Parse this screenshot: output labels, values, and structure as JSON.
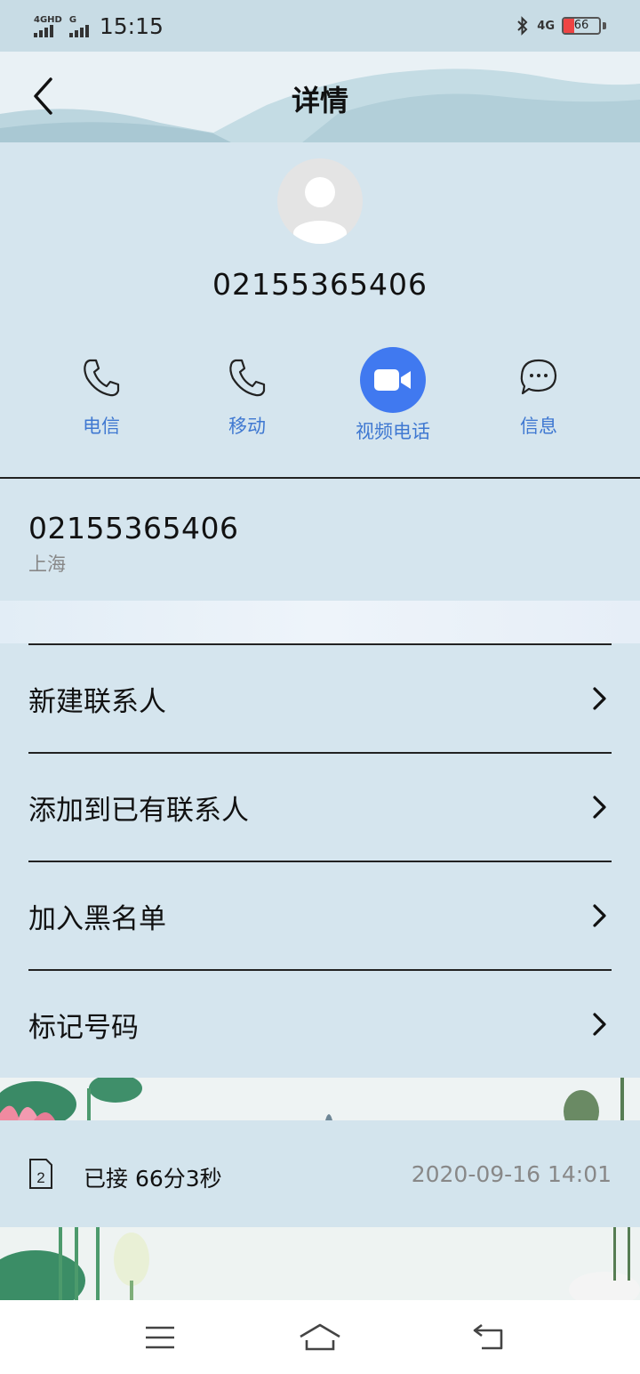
{
  "status_bar": {
    "sim1_label": "4GHD",
    "sim2_label": "G",
    "time": "15:15",
    "network": "4G",
    "battery": "66"
  },
  "header": {
    "title": "详情"
  },
  "contact": {
    "number": "02155365406"
  },
  "actions": [
    {
      "label": "电信",
      "icon": "phone-icon"
    },
    {
      "label": "移动",
      "icon": "phone-icon"
    },
    {
      "label": "视频电话",
      "icon": "video-camera-icon"
    },
    {
      "label": "信息",
      "icon": "message-icon"
    }
  ],
  "phone_entry": {
    "number": "02155365406",
    "location": "上海"
  },
  "menu": [
    {
      "label": "新建联系人"
    },
    {
      "label": "添加到已有联系人"
    },
    {
      "label": "加入黑名单"
    },
    {
      "label": "标记号码"
    }
  ],
  "call_log": {
    "sim": "2",
    "status": "已接 66分3秒",
    "datetime": "2020-09-16 14:01"
  },
  "colors": {
    "accent": "#4079f0",
    "action_label": "#3f78d1",
    "page_bg": "#d5e5ee"
  }
}
